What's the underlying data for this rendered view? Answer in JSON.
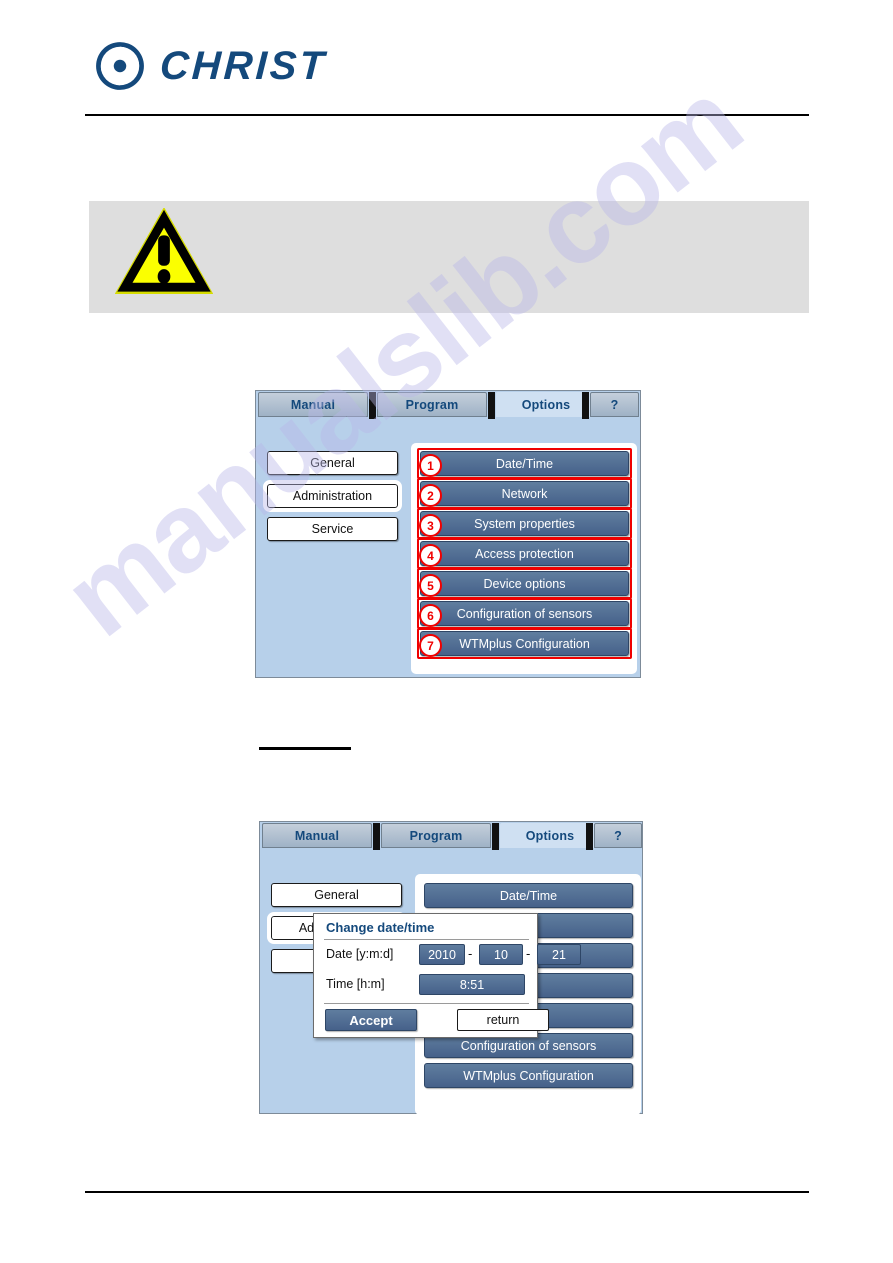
{
  "header": {
    "brand": "CHRIST",
    "logo_icon": "christ-swirl-logo"
  },
  "note": {
    "icon": "warning-triangle-icon",
    "text": ""
  },
  "watermark": {
    "text": "manualslib.com"
  },
  "screens": [
    {
      "id": "options-administration",
      "tabs": [
        {
          "label": "Manual",
          "active": false
        },
        {
          "label": "Program",
          "active": false
        },
        {
          "label": "Options",
          "active": true
        },
        {
          "label": "?",
          "active": false
        }
      ],
      "side_menu": [
        {
          "label": "General",
          "selected": false
        },
        {
          "label": "Administration",
          "selected": true
        },
        {
          "label": "Service",
          "selected": false
        }
      ],
      "options": [
        {
          "badge": "1",
          "label": "Date/Time"
        },
        {
          "badge": "2",
          "label": "Network"
        },
        {
          "badge": "3",
          "label": "System properties"
        },
        {
          "badge": "4",
          "label": "Access protection"
        },
        {
          "badge": "5",
          "label": "Device options"
        },
        {
          "badge": "6",
          "label": "Configuration of sensors"
        },
        {
          "badge": "7",
          "label": "WTMplus Configuration"
        }
      ]
    },
    {
      "id": "options-change-date-time",
      "tabs": [
        {
          "label": "Manual",
          "active": false
        },
        {
          "label": "Program",
          "active": false
        },
        {
          "label": "Options",
          "active": true
        },
        {
          "label": "?",
          "active": false
        }
      ],
      "side_menu": [
        {
          "label": "General",
          "selected": false
        },
        {
          "label": "Ad",
          "selected": true
        },
        {
          "label": "",
          "selected": false
        }
      ],
      "options": [
        {
          "label": "Date/Time"
        },
        {
          "label": ""
        },
        {
          "label": ""
        },
        {
          "label": ""
        },
        {
          "label": ""
        },
        {
          "label": "Configuration of sensors"
        },
        {
          "label": "WTMplus Configuration"
        }
      ],
      "dialog": {
        "title": "Change date/time",
        "date_label": "Date [y:m:d]",
        "date_year": "2010",
        "date_month": "10",
        "date_day": "21",
        "separator": "-",
        "time_label": "Time [h:m]",
        "time_value": "8:51",
        "accept_label": "Accept",
        "return_label": "return"
      }
    }
  ],
  "colors": {
    "brand_blue": "#14497c",
    "screen_bg": "#b7d0ea",
    "button_blue": "#4d6b91",
    "callout_red": "#f00000",
    "note_bg": "#dedede",
    "warning_yellow": "#fbff00"
  }
}
